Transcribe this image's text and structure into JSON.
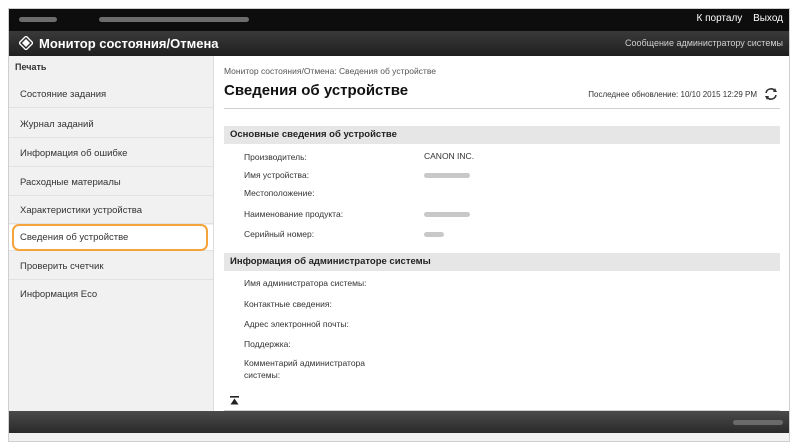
{
  "topbar": {
    "portal_link": "К порталу",
    "logout_link": "Выход"
  },
  "header": {
    "title": "Монитор состояния/Отмена",
    "admin_message_link": "Сообщение администратору системы"
  },
  "sidebar": {
    "heading": "Печать",
    "items": [
      {
        "label": "Состояние задания"
      },
      {
        "label": "Журнал заданий"
      },
      {
        "label": "Информация об ошибке"
      },
      {
        "label": "Расходные материалы"
      },
      {
        "label": "Характеристики устройства"
      },
      {
        "label": "Сведения об устройстве"
      },
      {
        "label": "Проверить счетчик"
      },
      {
        "label": "Информация Eco"
      }
    ],
    "active_index": 5
  },
  "main": {
    "breadcrumb": "Монитор состояния/Отмена: Сведения об устройстве",
    "title": "Сведения об устройстве",
    "last_update": "Последнее обновление: 10/10 2015 12:29 PM",
    "basic_section": {
      "heading": "Основные сведения об устройстве",
      "rows": [
        {
          "label": "Производитель:",
          "value": "CANON INC."
        },
        {
          "label": "Имя устройства:",
          "value": ""
        },
        {
          "label": "Местоположение:",
          "value": ""
        },
        {
          "label": "Наименование продукта:",
          "value": ""
        },
        {
          "label": "Серийный номер:",
          "value": ""
        }
      ]
    },
    "admin_section": {
      "heading": "Информация об администраторе системы",
      "rows": [
        {
          "label": "Имя администратора системы:"
        },
        {
          "label": "Контактные сведения:"
        },
        {
          "label": "Адрес электронной почты:"
        },
        {
          "label": "Поддержка:"
        },
        {
          "label_line1": "Комментарий администратора",
          "label_line2": "системы:"
        }
      ]
    }
  },
  "colors": {
    "highlight": "#f5a33b",
    "topbar": "#0d0d0d",
    "titlebar": "#2b2b2b"
  },
  "icons": {
    "logo": "canon-diamond-icon",
    "refresh": "refresh-icon",
    "to_top": "to-top-icon"
  }
}
